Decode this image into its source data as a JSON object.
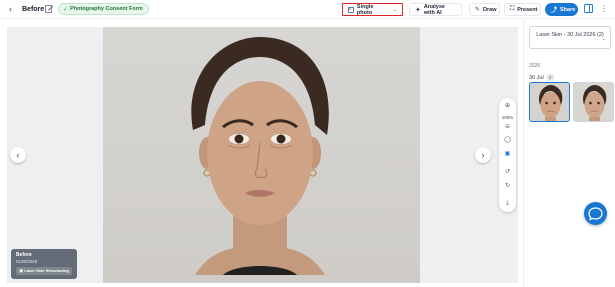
{
  "header": {
    "back_icon": "chevron-left-icon",
    "title": "Before",
    "edit_icon": "pencil-icon",
    "consent_label": "Photography Consent Form",
    "view_mode_label": "Single photo",
    "analyse_label": "Analyse with AI",
    "draw_label": "Draw",
    "present_label": "Present",
    "share_label": "Share",
    "highlight_color": "#e02424",
    "accent_color": "#1976d2"
  },
  "viewer": {
    "zoom_level": "100%",
    "overlay": {
      "title": "Before",
      "date": "0130/2026",
      "tag": "Laser Skin Resurfacing"
    }
  },
  "sidebar": {
    "session_label": "Laser Skin - 30 Jul 2026 (2)",
    "year": "2026",
    "day_label": "30 Jul",
    "day_count": "2"
  }
}
